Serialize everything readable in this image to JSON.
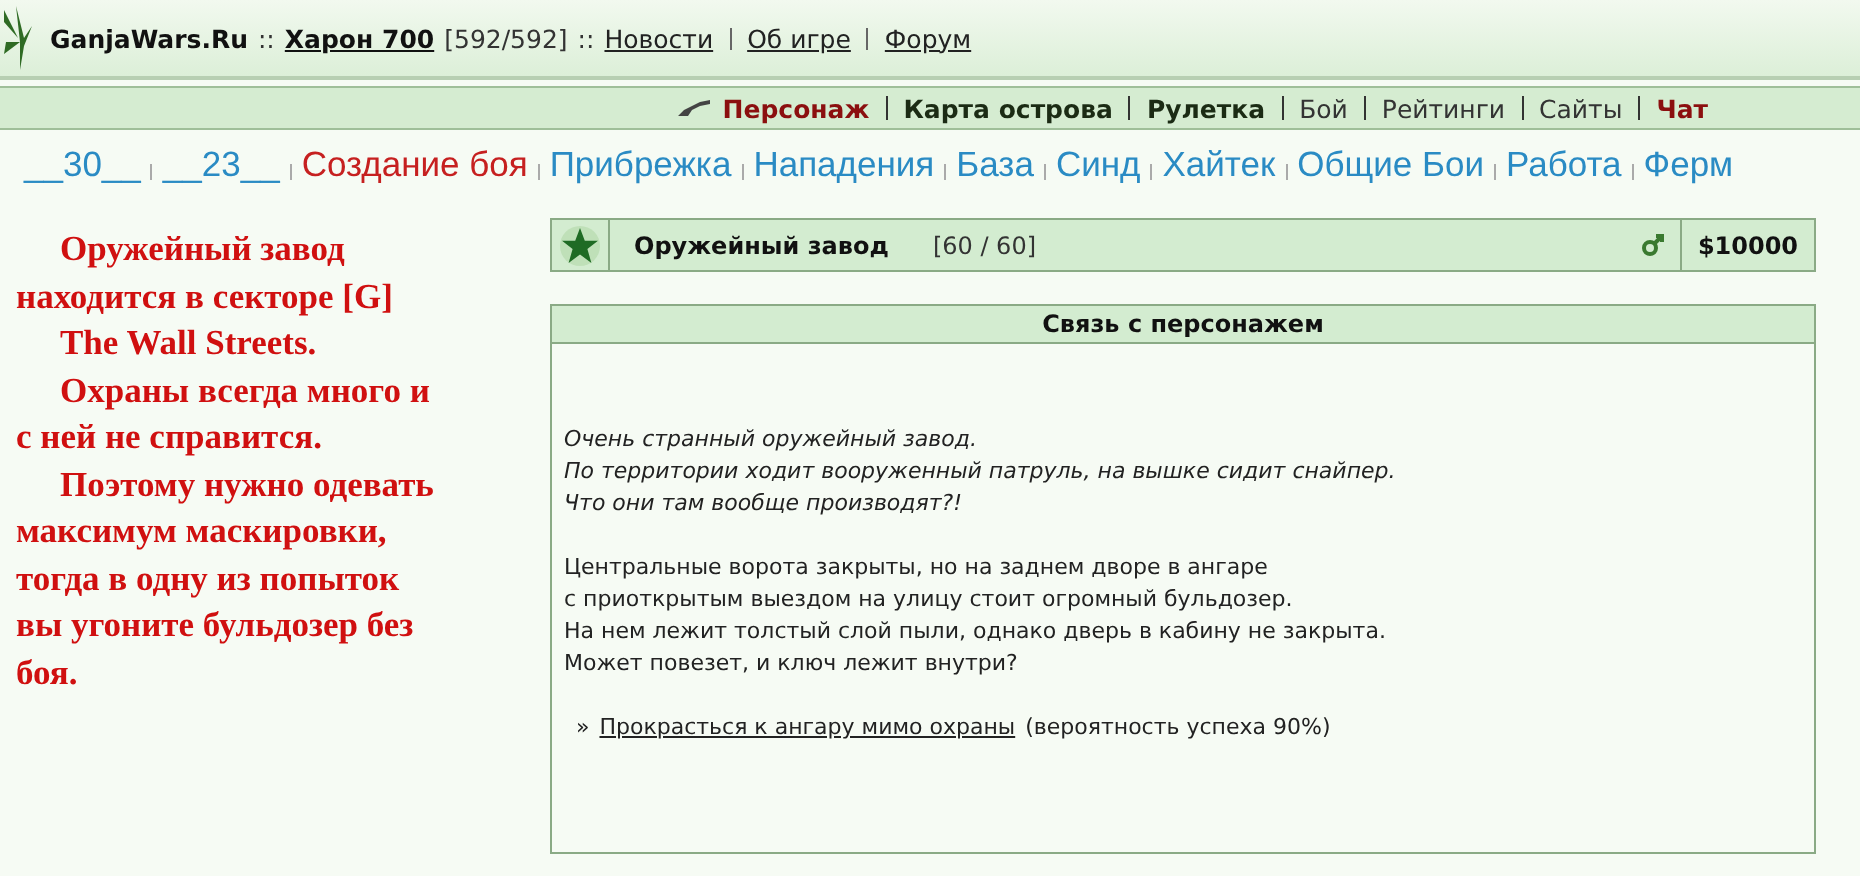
{
  "header": {
    "site": "GanjaWars.Ru",
    "sep1": "::",
    "player": "Харон 700",
    "hp": "[592/592]",
    "sep2": "::",
    "links": [
      "Новости",
      "Об игре",
      "Форум"
    ]
  },
  "menu": [
    {
      "label": "Персонаж",
      "kind": "highlight"
    },
    {
      "label": "Карта острова",
      "kind": "bold"
    },
    {
      "label": "Рулетка",
      "kind": "bold"
    },
    {
      "label": "Бой",
      "kind": "plain"
    },
    {
      "label": "Рейтинги",
      "kind": "plain"
    },
    {
      "label": "Сайты",
      "kind": "plain"
    },
    {
      "label": "Чат",
      "kind": "highlight"
    }
  ],
  "nav": [
    {
      "label": "__30__",
      "selected": false
    },
    {
      "label": "__23__",
      "selected": false
    },
    {
      "label": "Создание боя",
      "selected": true
    },
    {
      "label": "Прибрежка",
      "selected": false
    },
    {
      "label": "Нападения",
      "selected": false
    },
    {
      "label": "База",
      "selected": false
    },
    {
      "label": "Синд",
      "selected": false
    },
    {
      "label": "Хайтек",
      "selected": false
    },
    {
      "label": "Общие Бои",
      "selected": false
    },
    {
      "label": "Работа",
      "selected": false
    },
    {
      "label": "Ферм",
      "selected": false
    }
  ],
  "note": {
    "lines": [
      "Оружейный завод",
      "находится в секторе [G]",
      "The Wall Streets.",
      "Охраны всегда много и",
      "с ней не справится.",
      "Поэтому нужно одевать",
      "максимум маскировки,",
      "тогда в одну из попыток",
      "вы угоните бульдозер без",
      "боя."
    ],
    "indented": [
      true,
      false,
      true,
      true,
      false,
      true,
      false,
      false,
      false,
      false
    ]
  },
  "object": {
    "name": "Оружейный завод",
    "count": "[60 / 60]",
    "price": "$10000"
  },
  "dialog": {
    "title": "Связь с персонажем",
    "intro": [
      "Очень странный оружейный завод.",
      "По территории ходит вооруженный патруль, на вышке сидит снайпер.",
      "Что они там вообще производят?!"
    ],
    "story": [
      "Центральные ворота закрыты, но на заднем дворе в ангаре",
      "с приоткрытым выездом на улицу стоит огромный бульдозер.",
      "На нем лежит толстый слой пыли, однако дверь в кабину не закрыта.",
      "Может повезет, и ключ лежит внутри?"
    ],
    "action": {
      "bullet": "»",
      "link": "Прокрасться к ангару мимо охраны",
      "note": "(вероятность успеха 90%)"
    }
  }
}
